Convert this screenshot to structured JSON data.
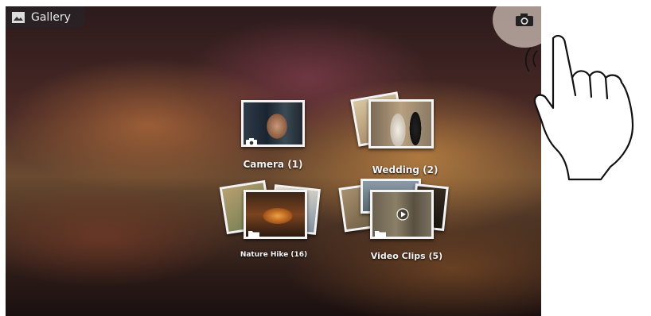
{
  "app_bar": {
    "title": "Gallery",
    "icon": "gallery-icon"
  },
  "camera_button": {
    "icon": "camera-icon"
  },
  "albums": [
    {
      "label": "Camera  (1)",
      "badge_icon": "camera-icon"
    },
    {
      "label": "Wedding  (2)",
      "badge_icon": "none"
    },
    {
      "label": "Nature Hike  (16)",
      "badge_icon": "folder-icon"
    },
    {
      "label": "Video Clips  (5)",
      "badge_icon": "folder-icon",
      "overlay_icon": "play-icon"
    }
  ],
  "colors": {
    "label": "#f4f4f4",
    "bar": "#28222480",
    "frame": "#f3f3f3"
  }
}
